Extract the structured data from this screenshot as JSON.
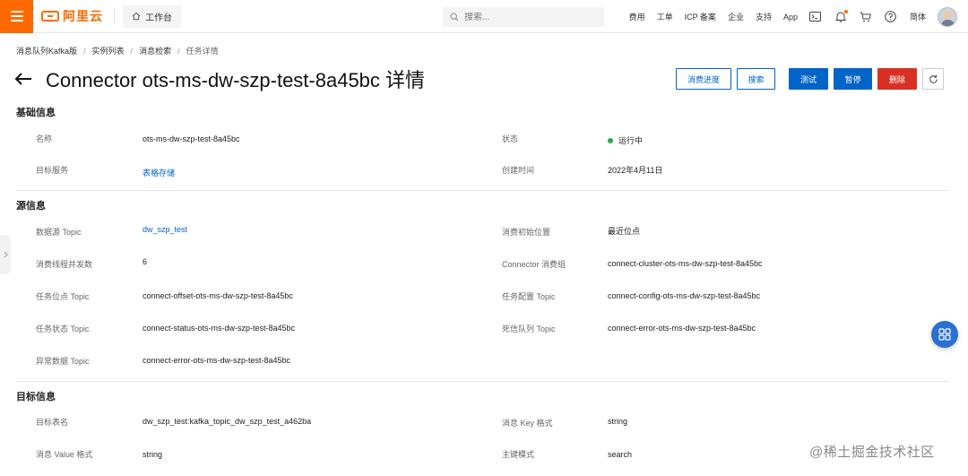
{
  "topbar": {
    "brand": "阿里云",
    "workbench": "工作台",
    "search_placeholder": "搜索...",
    "nav_items": [
      "费用",
      "工单",
      "ICP 备案",
      "企业",
      "支持",
      "App"
    ],
    "language": "简体",
    "accent_color": "#ff6a00"
  },
  "breadcrumb": [
    "消息队列Kafka版",
    "实例列表",
    "消息检索",
    "任务详情"
  ],
  "header": {
    "title": "Connector ots-ms-dw-szp-test-8a45bc 详情",
    "buttons": {
      "consume_progress": "消费进度",
      "search": "搜索",
      "test": "测试",
      "pause": "暂停",
      "delete": "删除"
    }
  },
  "basic": {
    "title": "基础信息",
    "name_label": "名称",
    "name_value": "ots-ms-dw-szp-test-8a45bc",
    "status_label": "状态",
    "status_value": "运行中",
    "target_service_label": "目标服务",
    "target_service_value": "表格存储",
    "created_label": "创建时间",
    "created_value": "2022年4月11日"
  },
  "source": {
    "title": "源信息",
    "rows": [
      {
        "l_label": "数据源 Topic",
        "l_value": "dw_szp_test",
        "r_label": "消费初始位置",
        "r_value": "最近位点"
      },
      {
        "l_label": "消费线程并发数",
        "l_value": "6",
        "r_label": "Connector 消费组",
        "r_value": "connect-cluster-ots-ms-dw-szp-test-8a45bc"
      },
      {
        "l_label": "任务位点 Topic",
        "l_value": "connect-offset-ots-ms-dw-szp-test-8a45bc",
        "r_label": "任务配置 Topic",
        "r_value": "connect-config-ots-ms-dw-szp-test-8a45bc"
      },
      {
        "l_label": "任务状态 Topic",
        "l_value": "connect-status-ots-ms-dw-szp-test-8a45bc",
        "r_label": "死信队列 Topic",
        "r_value": "connect-error-ots-ms-dw-szp-test-8a45bc"
      },
      {
        "l_label": "异常数据 Topic",
        "l_value": "connect-error-ots-ms-dw-szp-test-8a45bc"
      }
    ]
  },
  "target": {
    "title": "目标信息",
    "table_label": "目标表名",
    "table_value": "dw_szp_test:kafka_topic_dw_szp_test_a462ba",
    "key_format_label": "消息 Key 格式",
    "key_format_value": "string",
    "value_format_label": "消息 Value 格式",
    "value_format_value": "string",
    "pk_mode_label": "主键模式",
    "pk_mode_value": "search"
  },
  "watermark": "@稀土掘金技术社区"
}
